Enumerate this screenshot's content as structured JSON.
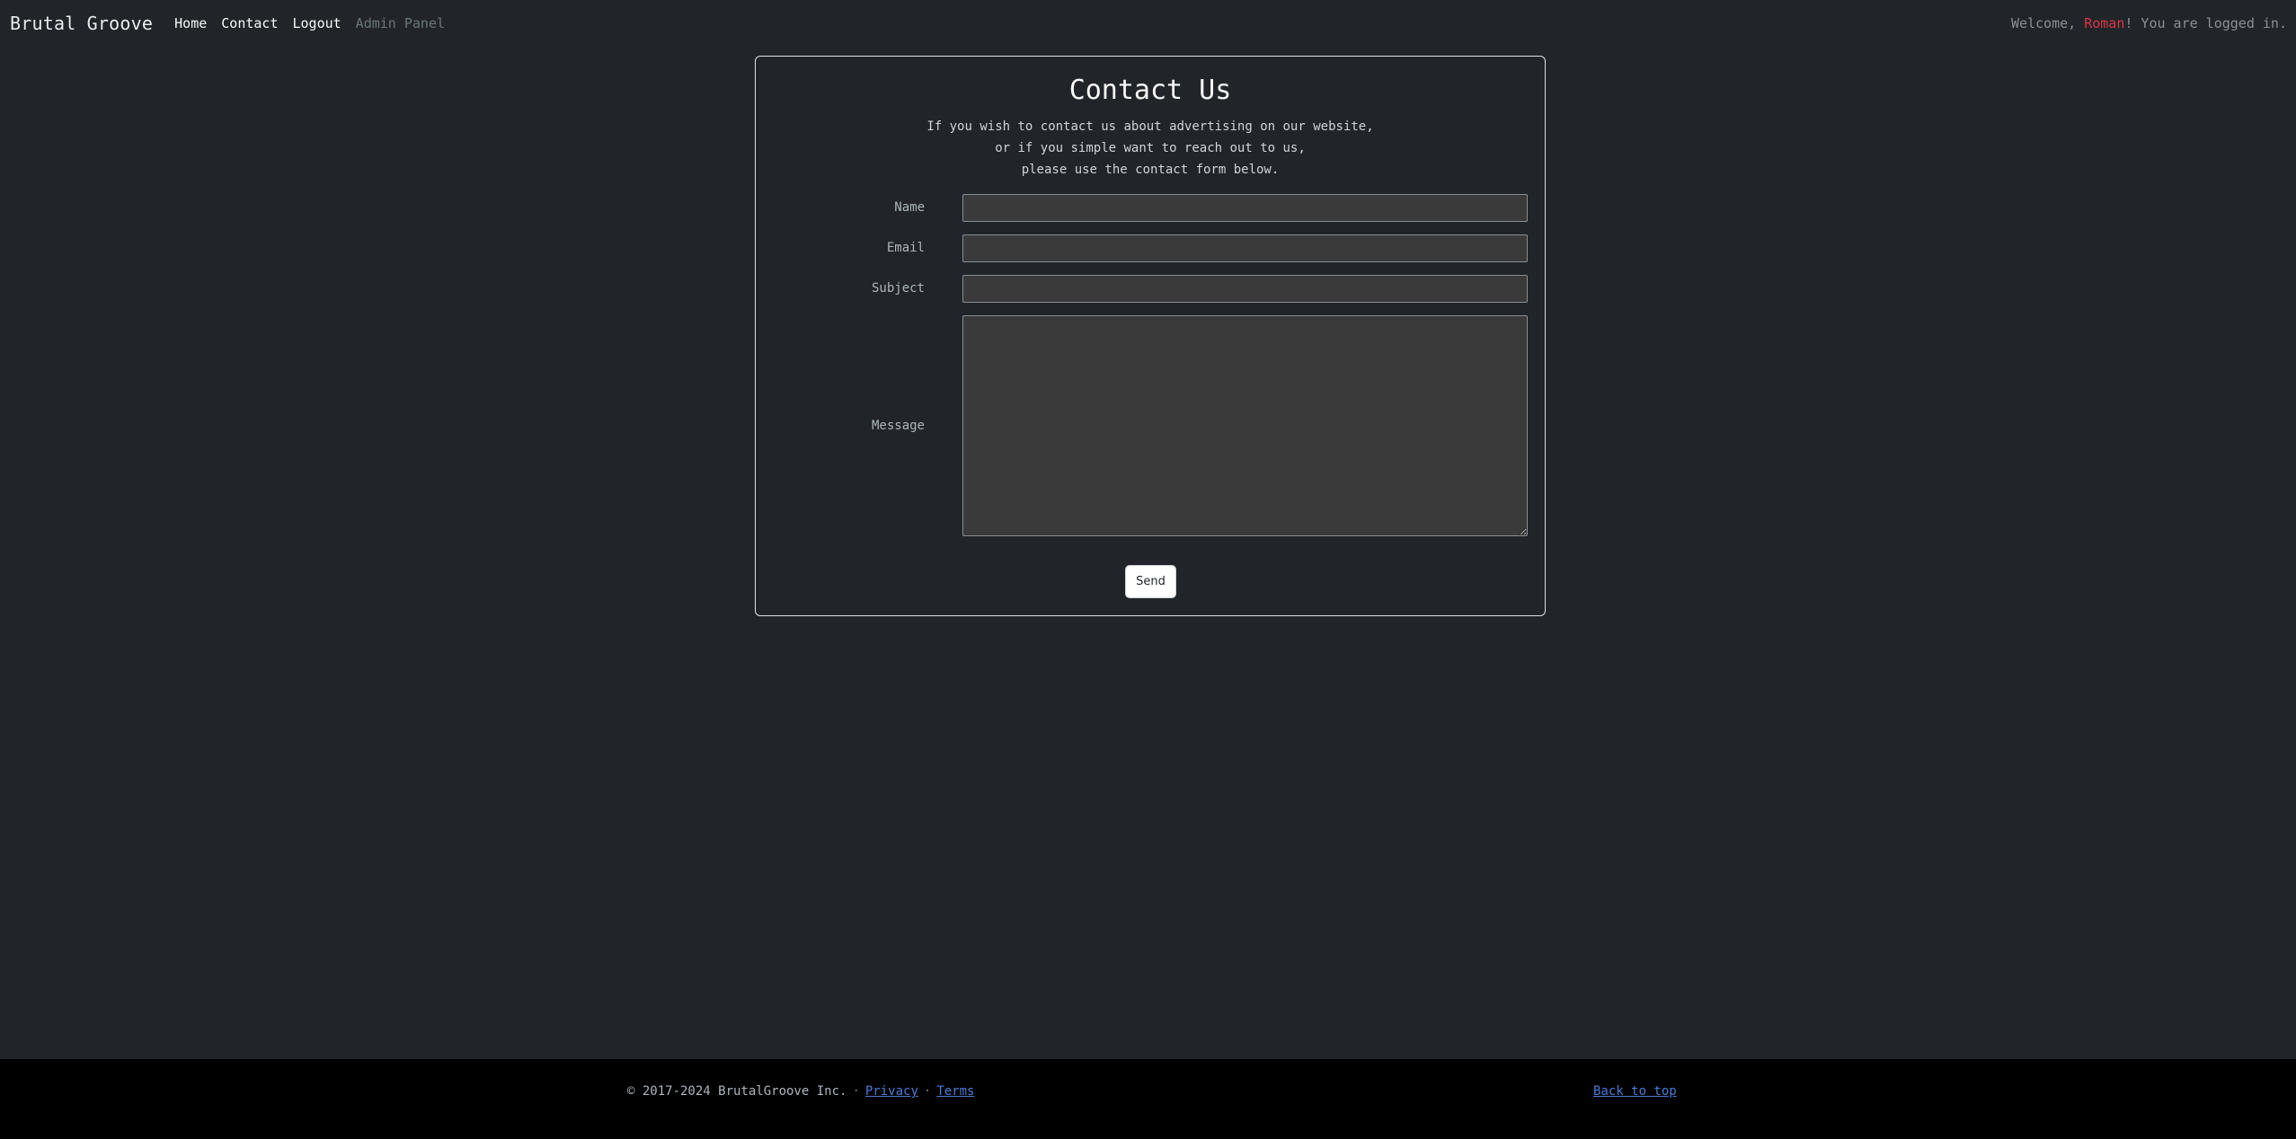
{
  "navbar": {
    "brand": "Brutal Groove",
    "links": [
      "Home",
      "Contact",
      "Logout",
      "Admin Panel"
    ],
    "welcome_prefix": "Welcome, ",
    "username": "Roman",
    "welcome_suffix": "! You are logged in."
  },
  "contact": {
    "title": "Contact Us",
    "intro": [
      "If you wish to contact us about advertising on our website,",
      "or if you simple want to reach out to us,",
      "please use the contact form below."
    ],
    "fields": {
      "name_label": "Name",
      "name_value": "",
      "email_label": "Email",
      "email_value": "",
      "subject_label": "Subject",
      "subject_value": "",
      "message_label": "Message",
      "message_value": ""
    },
    "send_label": "Send"
  },
  "footer": {
    "copyright": "© 2017-2024 BrutalGroove Inc.",
    "separator": "·",
    "privacy": "Privacy",
    "terms": "Terms",
    "back_to_top": "Back to top"
  },
  "colors": {
    "background": "#212529",
    "username": "#dc3545",
    "link": "#4a7bd6",
    "footer_bg": "#000000"
  }
}
